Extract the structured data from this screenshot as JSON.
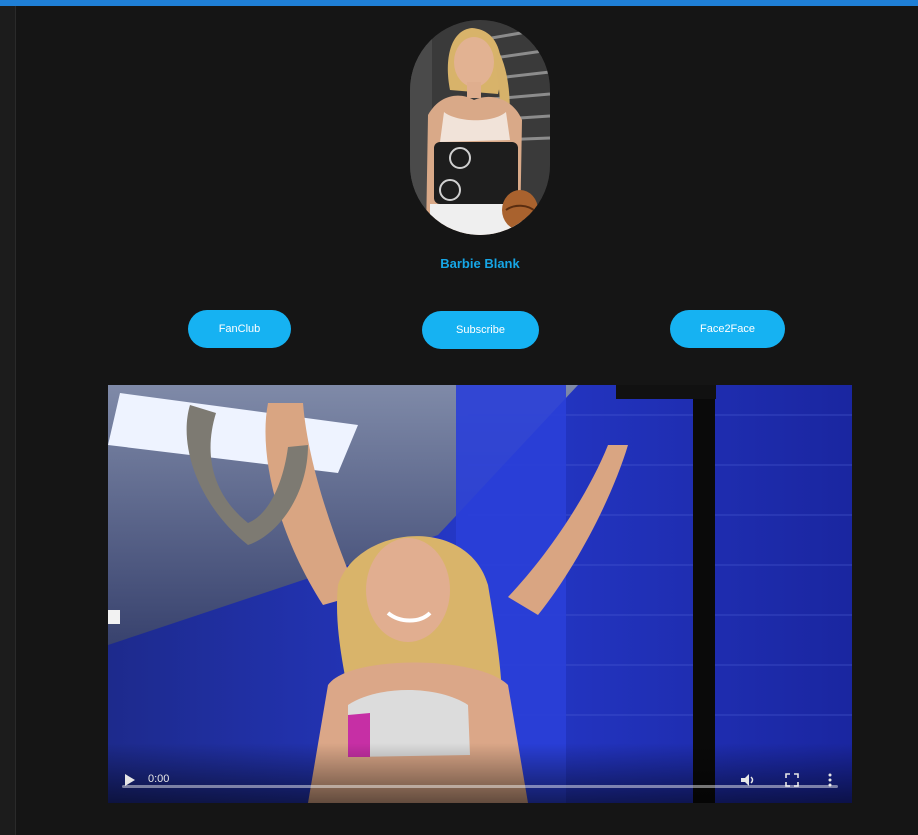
{
  "profile": {
    "name": "Barbie Blank",
    "avatar_icon": "profile-photo"
  },
  "buttons": {
    "fanclub_label": "FanClub",
    "subscribe_label": "Subscribe",
    "face2face_label": "Face2Face"
  },
  "video": {
    "current_time": "0:00",
    "progress": 0
  },
  "colors": {
    "accent": "#16b2f2",
    "name_text": "#16a6e6",
    "top_bar": "#1f7fd6",
    "background": "#151515"
  }
}
